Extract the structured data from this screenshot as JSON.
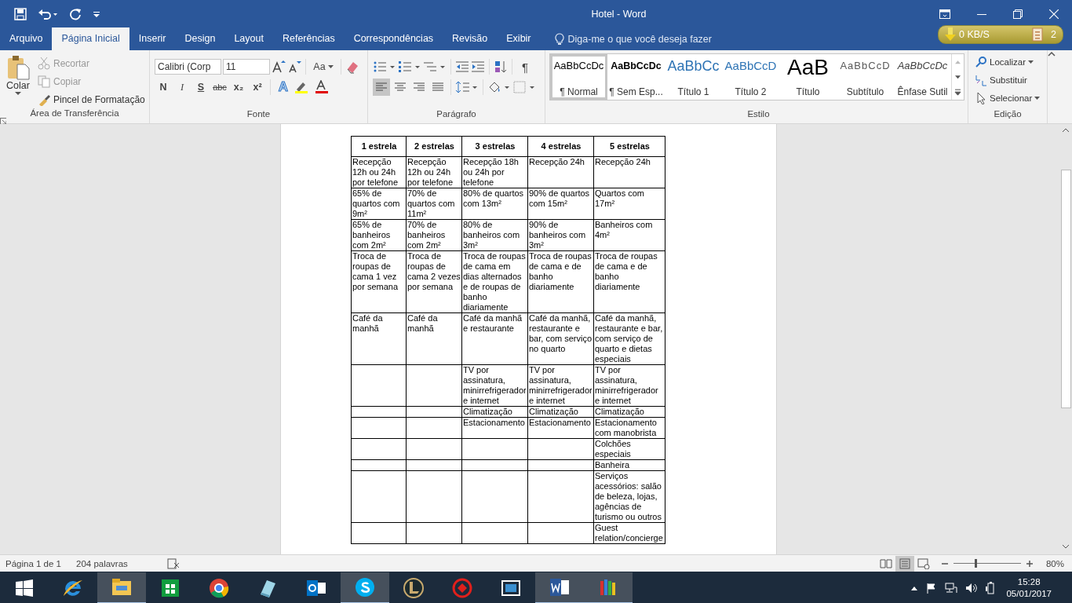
{
  "window": {
    "title": "Hotel  -  Word"
  },
  "tabs": [
    {
      "label": "Arquivo",
      "selected": false
    },
    {
      "label": "Página Inicial",
      "selected": true
    },
    {
      "label": "Inserir",
      "selected": false
    },
    {
      "label": "Design",
      "selected": false
    },
    {
      "label": "Layout",
      "selected": false
    },
    {
      "label": "Referências",
      "selected": false
    },
    {
      "label": "Correspondências",
      "selected": false
    },
    {
      "label": "Revisão",
      "selected": false
    },
    {
      "label": "Exibir",
      "selected": false
    }
  ],
  "tell_me": {
    "placeholder": "Diga-me o que você deseja fazer"
  },
  "network_widget": {
    "speed": "0 KB/S",
    "count": "2"
  },
  "clipboard": {
    "paste": "Colar",
    "items": [
      {
        "label": "Recortar",
        "disabled": true
      },
      {
        "label": "Copiar",
        "disabled": true
      },
      {
        "label": "Pincel de Formatação",
        "disabled": false
      }
    ],
    "label": "Área de Transferência"
  },
  "font": {
    "name": "Calibri (Corp",
    "size": "11",
    "case_button": "Aa",
    "effects_glyph": "A",
    "format_buttons": [
      "N",
      "I",
      "S",
      "abc",
      "x₂",
      "x²"
    ],
    "label": "Fonte"
  },
  "paragraph": {
    "pilcrow": "¶",
    "alignments": [
      {
        "selected": true
      },
      {
        "selected": false
      },
      {
        "selected": false
      },
      {
        "selected": false
      }
    ],
    "label": "Parágrafo"
  },
  "styles": {
    "items": [
      {
        "preview": "AaBbCcDc",
        "name": "¶ Normal",
        "kind": "normal",
        "selected": true
      },
      {
        "preview": "AaBbCcDc",
        "name": "¶ Sem Esp...",
        "kind": "bold",
        "selected": false
      },
      {
        "preview": "AaBbCc",
        "name": "Título 1",
        "kind": "heading1",
        "selected": false
      },
      {
        "preview": "AaBbCcD",
        "name": "Título 2",
        "kind": "heading2",
        "selected": false
      },
      {
        "preview": "AaB",
        "name": "Título",
        "kind": "title",
        "selected": false
      },
      {
        "preview": "AaBbCcD",
        "name": "Subtítulo",
        "kind": "subtitle",
        "selected": false
      },
      {
        "preview": "AaBbCcDc",
        "name": "Ênfase Sutil",
        "kind": "emphasis",
        "selected": false
      }
    ],
    "label": "Estilo"
  },
  "editing": {
    "items": [
      "Localizar",
      "Substituir",
      "Selecionar"
    ],
    "label": "Edição"
  },
  "table": {
    "columns": [
      "1 estrela",
      "2 estrelas",
      "3 estrelas",
      "4 estrelas",
      "5 estrelas"
    ],
    "rows": [
      [
        "Recepção 12h ou 24h por telefone",
        "Recepção 12h ou 24h por telefone",
        "Recepção 18h ou 24h por telefone",
        "Recepção 24h",
        "Recepção 24h"
      ],
      [
        "65% de quartos com 9m²",
        "70% de quartos com 11m²",
        "80% de quartos com 13m²",
        "90% de quartos com 15m²",
        "Quartos com 17m²"
      ],
      [
        "65% de banheiros com 2m²",
        "70% de banheiros com 2m²",
        "80% de banheiros com 3m²",
        "90% de banheiros com 3m²",
        "Banheiros com 4m²"
      ],
      [
        "Troca de roupas de cama 1 vez por semana",
        "Troca de roupas de cama 2 vezes por semana",
        "Troca de roupas de cama em dias alternados e de roupas de banho diariamente",
        "Troca de roupas de cama e de banho diariamente",
        "Troca de roupas de cama e de banho diariamente"
      ],
      [
        "Café da manhã",
        "Café da manhã",
        "Café da manhã e restaurante",
        "Café da manhã, restaurante e bar, com serviço no quarto",
        "Café da manhã, restaurante e bar, com serviço de quarto e dietas especiais"
      ],
      [
        null,
        null,
        "TV por assinatura, minirrefrigerador e internet",
        "TV por assinatura, minirrefrigerador e internet",
        "TV por assinatura, minirrefrigerador e internet"
      ],
      [
        null,
        null,
        "Climatização",
        "Climatização",
        "Climatização"
      ],
      [
        null,
        null,
        "Estacionamento",
        "Estacionamento",
        "Estacionamento com manobrista"
      ],
      [
        null,
        null,
        null,
        null,
        "Colchões especiais"
      ],
      [
        null,
        null,
        null,
        null,
        "Banheira"
      ],
      [
        null,
        null,
        null,
        null,
        "Serviços acessórios: salão de beleza, lojas, agências de turismo ou outros"
      ],
      [
        null,
        null,
        null,
        null,
        "Guest relation/concierge"
      ]
    ]
  },
  "status_bar": {
    "page": "Página 1 de 1",
    "words": "204 palavras",
    "views": [
      {
        "selected": false
      },
      {
        "selected": true
      },
      {
        "selected": false
      }
    ],
    "zoom": "80%",
    "zoom_level": {
      "level": 0.33
    }
  },
  "taskbar": {
    "apps": [
      {
        "kind": "ie",
        "selected": false
      },
      {
        "kind": "explorer",
        "selected": true
      },
      {
        "kind": "store",
        "selected": false
      },
      {
        "kind": "chrome",
        "selected": false
      },
      {
        "kind": "notes",
        "selected": false
      },
      {
        "kind": "outlook",
        "selected": false
      },
      {
        "kind": "skype",
        "selected": true
      },
      {
        "kind": "game",
        "selected": false
      },
      {
        "kind": "tool",
        "selected": false
      },
      {
        "kind": "video",
        "selected": false
      },
      {
        "kind": "word",
        "selected": true
      },
      {
        "kind": "books",
        "selected": true
      }
    ],
    "time": "15:28",
    "date": "05/01/2017"
  }
}
